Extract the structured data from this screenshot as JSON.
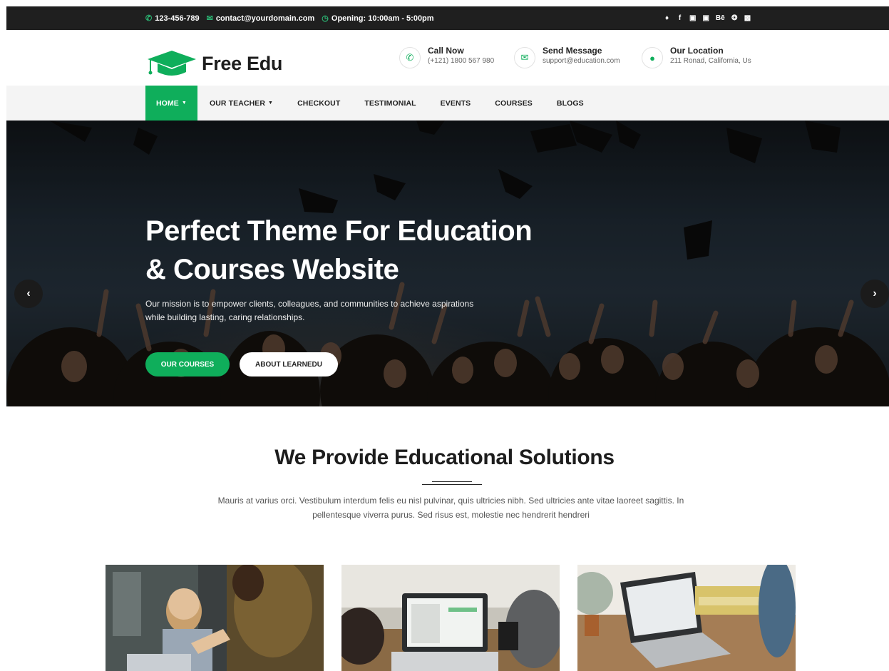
{
  "topbar": {
    "phone": "123-456-789",
    "email": "contact@yourdomain.com",
    "opening": "Opening: 10:00am - 5:00pm",
    "social_icons": [
      "twitter-icon",
      "facebook-icon",
      "google-plus-icon",
      "linkedin-icon",
      "behance-icon",
      "dribbble-icon",
      "youtube-icon"
    ]
  },
  "header": {
    "brand": "Free Edu",
    "info": [
      {
        "icon": "phone-icon",
        "title": "Call Now",
        "detail": "(+121) 1800 567 980"
      },
      {
        "icon": "envelope-icon",
        "title": "Send Message",
        "detail": "support@education.com"
      },
      {
        "icon": "map-marker-icon",
        "title": "Our Location",
        "detail": "211 Ronad, California, Us"
      }
    ]
  },
  "nav": {
    "items": [
      {
        "label": "HOME",
        "dropdown": true,
        "active": true
      },
      {
        "label": "OUR TEACHER",
        "dropdown": true,
        "active": false
      },
      {
        "label": "CHECKOUT",
        "dropdown": false,
        "active": false
      },
      {
        "label": "TESTIMONIAL",
        "dropdown": false,
        "active": false
      },
      {
        "label": "EVENTS",
        "dropdown": false,
        "active": false
      },
      {
        "label": "COURSES",
        "dropdown": false,
        "active": false
      },
      {
        "label": "BLOGS",
        "dropdown": false,
        "active": false
      }
    ]
  },
  "hero": {
    "title_line1": "Perfect Theme For Education",
    "title_line2": "& Courses Website",
    "subtitle_line1": "Our mission is to empower clients, colleagues, and communities to achieve aspirations",
    "subtitle_line2": "while building lasting, caring relationships.",
    "primary_button": "OUR COURSES",
    "secondary_button": "ABOUT LEARNEDU",
    "prev_arrow": "‹",
    "next_arrow": "›"
  },
  "section": {
    "title": "We Provide Educational Solutions",
    "description_line1": "Mauris at varius orci. Vestibulum interdum felis eu nisl pulvinar, quis ultricies nibh. Sed ultricies ante vitae laoreet sagittis. In",
    "description_line2": "pellentesque viverra purus. Sed risus est, molestie nec hendrerit hendreri"
  },
  "colors": {
    "accent": "#0fae5b",
    "topbar": "#1f1f1f",
    "nav_bg": "#f4f4f4"
  }
}
